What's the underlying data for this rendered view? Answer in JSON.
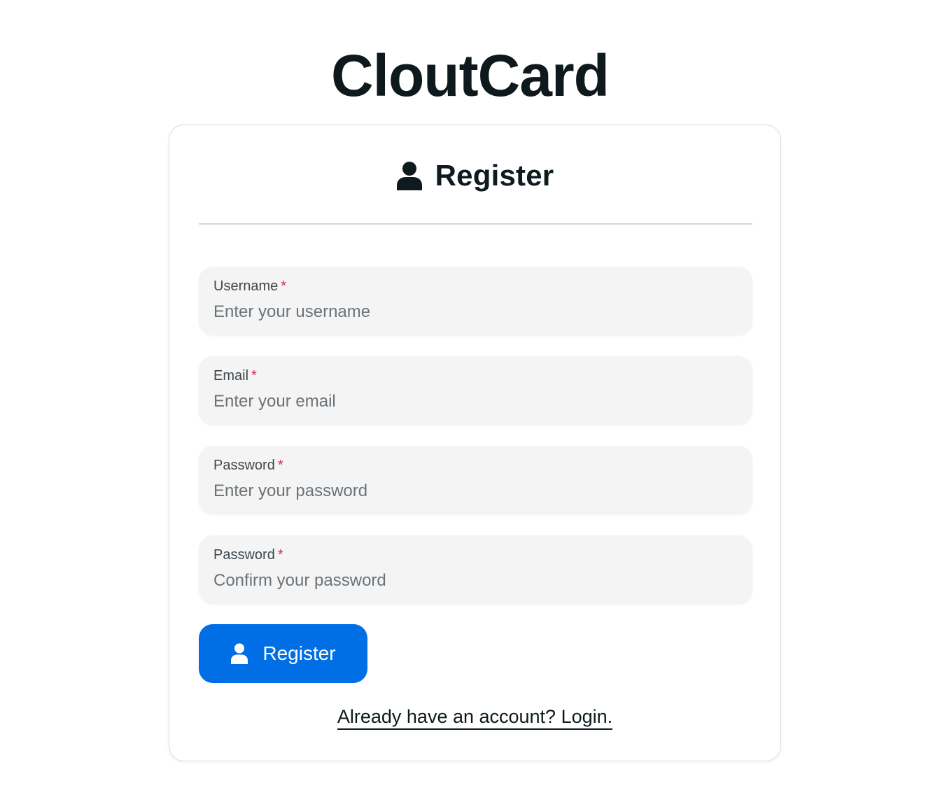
{
  "app": {
    "title": "CloutCard"
  },
  "form": {
    "heading": "Register",
    "heading_icon": "user-icon",
    "fields": [
      {
        "label": "Username",
        "required_marker": "*",
        "placeholder": "Enter your username",
        "value": ""
      },
      {
        "label": "Email",
        "required_marker": "*",
        "placeholder": "Enter your email",
        "value": ""
      },
      {
        "label": "Password",
        "required_marker": "*",
        "placeholder": "Enter your password",
        "value": ""
      },
      {
        "label": "Password",
        "required_marker": "*",
        "placeholder": "Confirm your password",
        "value": ""
      }
    ],
    "submit": {
      "label": "Register",
      "icon": "user-icon"
    },
    "login_link": "Already have an account? Login."
  },
  "colors": {
    "accent": "#006fe6",
    "required": "#d6245a",
    "field_bg": "#f4f4f5",
    "text": "#0f1a1e"
  }
}
